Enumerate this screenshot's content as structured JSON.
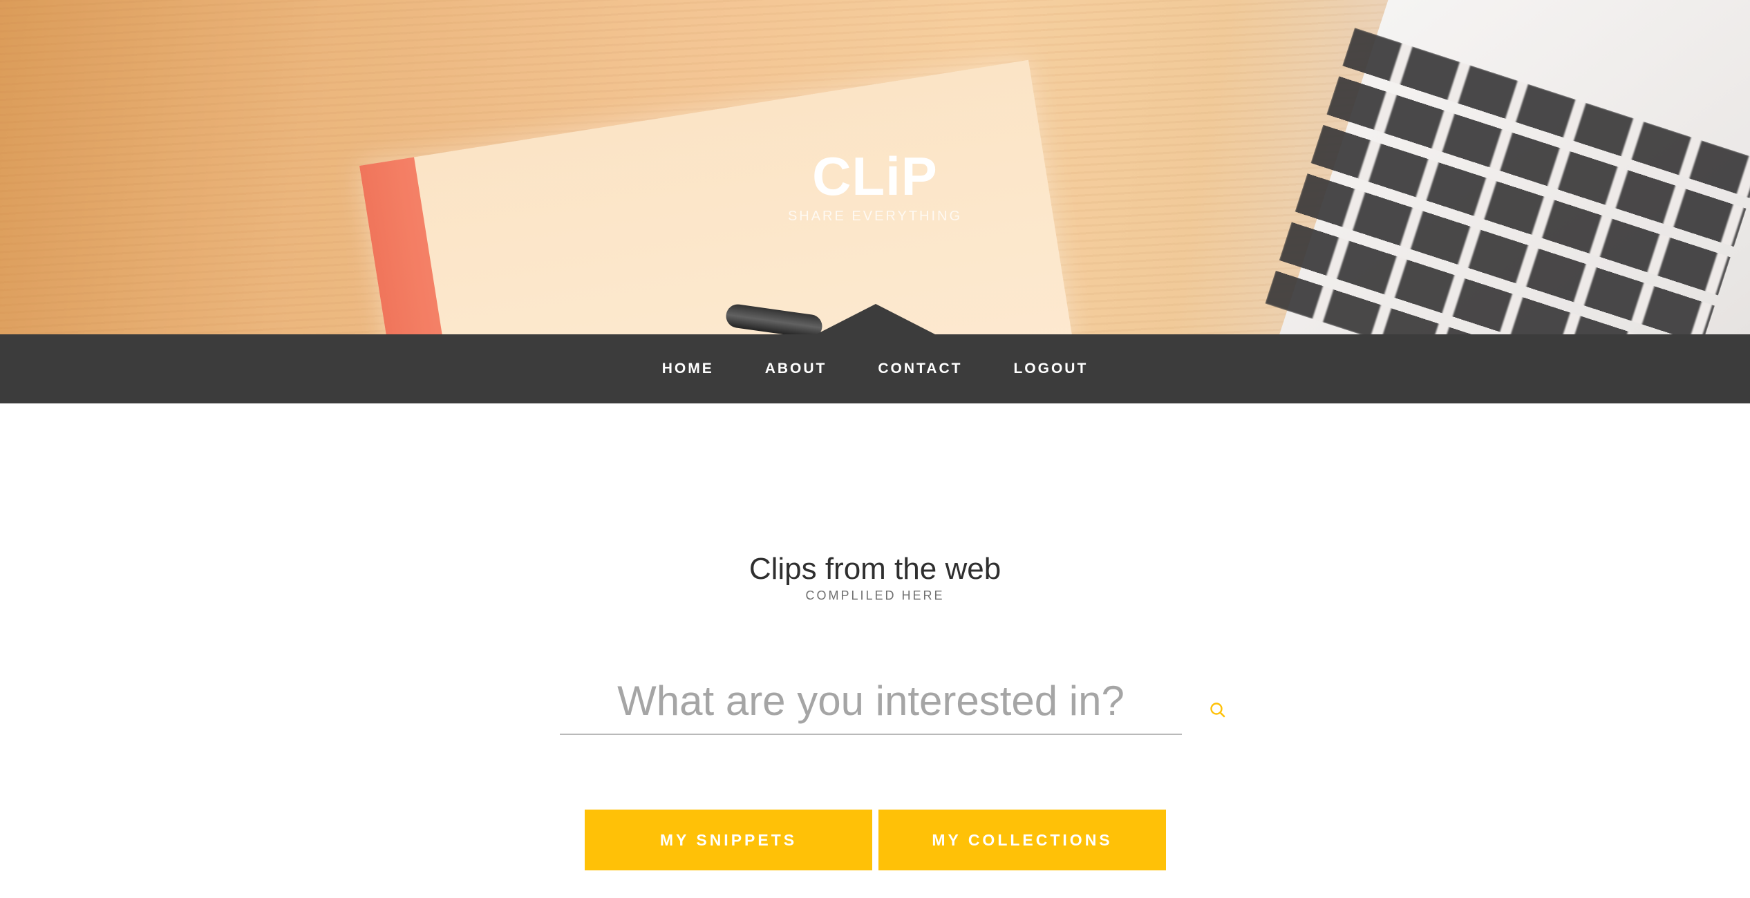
{
  "hero": {
    "brand": "CLiP",
    "tagline": "SHARE EVERYTHING"
  },
  "nav": {
    "items": [
      {
        "label": "HOME"
      },
      {
        "label": "ABOUT"
      },
      {
        "label": "CONTACT"
      },
      {
        "label": "LOGOUT"
      }
    ]
  },
  "main": {
    "title": "Clips from the web",
    "subtitle": "COMPLILED HERE",
    "search": {
      "placeholder": "What are you interested in?",
      "value": "",
      "icon": "search-icon"
    },
    "buttons": {
      "snippets": "MY SNIPPETS",
      "collections": "MY COLLECTIONS"
    }
  },
  "colors": {
    "accent": "#ffc107",
    "nav_bg": "#3c3c3c",
    "text_dark": "#2f2f2f"
  }
}
